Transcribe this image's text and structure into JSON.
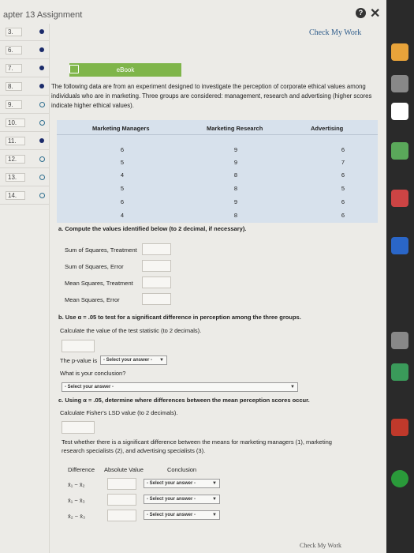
{
  "window": {
    "title": "apter 13 Assignment",
    "help_icon": "?",
    "close_icon": "✕"
  },
  "check_my_work": "Check My Work",
  "questions": [
    {
      "num": "3.",
      "state": "filled"
    },
    {
      "num": "6.",
      "state": "filled"
    },
    {
      "num": "7.",
      "state": "filled"
    },
    {
      "num": "8.",
      "state": "filled"
    },
    {
      "num": "9.",
      "state": "empty"
    },
    {
      "num": "10.",
      "state": "empty"
    },
    {
      "num": "11.",
      "state": "filled"
    },
    {
      "num": "12.",
      "state": "empty"
    },
    {
      "num": "13.",
      "state": "empty"
    },
    {
      "num": "14.",
      "state": "empty"
    }
  ],
  "ebook": {
    "label": "eBook"
  },
  "intro": "The following data are from an experiment designed to investigate the perception of corporate ethical values among individuals who are in marketing. Three groups are considered: management, research and advertising (higher scores indicate higher ethical values).",
  "table": {
    "headers": [
      "Marketing Managers",
      "Marketing Research",
      "Advertising"
    ],
    "rows": [
      [
        "6",
        "9",
        "6"
      ],
      [
        "5",
        "9",
        "7"
      ],
      [
        "4",
        "8",
        "6"
      ],
      [
        "5",
        "8",
        "5"
      ],
      [
        "6",
        "9",
        "6"
      ],
      [
        "4",
        "8",
        "6"
      ]
    ]
  },
  "part_a": {
    "prompt": "a. Compute the values identified below (to 2 decimal, if necessary).",
    "items": [
      "Sum of Squares, Treatment",
      "Sum of Squares, Error",
      "Mean Squares, Treatment",
      "Mean Squares, Error"
    ]
  },
  "part_b": {
    "prompt": "b. Use α = .05 to test for a significant difference in perception among the three groups.",
    "calc": "Calculate the value of the test statistic (to 2 decimals).",
    "pvalue_label": "The p-value is",
    "pvalue_select": "- Select your answer -",
    "conclusion_q": "What is your conclusion?",
    "conclusion_select": "- Select your answer -"
  },
  "part_c": {
    "prompt": "c. Using α = .05, determine where differences between the mean perception scores occur.",
    "calc": "Calculate Fisher's LSD value (to 2 decimals).",
    "test": "Test whether there is a significant difference between the means for marketing managers (1), marketing research specialists (2), and advertising specialists (3).",
    "headers": [
      "Difference",
      "Absolute Value",
      "Conclusion"
    ],
    "rows": [
      {
        "label": "x̄₁ − x̄₂",
        "select": "- Select your answer -"
      },
      {
        "label": "x̄₁ − x̄₃",
        "select": "- Select your answer -"
      },
      {
        "label": "x̄₂ − x̄₃",
        "select": "- Select your answer -"
      }
    ]
  },
  "colors": {
    "ebook_green": "#7fb54a",
    "table_blue": "#d7e1ec",
    "link_blue": "#2d5b8a"
  }
}
